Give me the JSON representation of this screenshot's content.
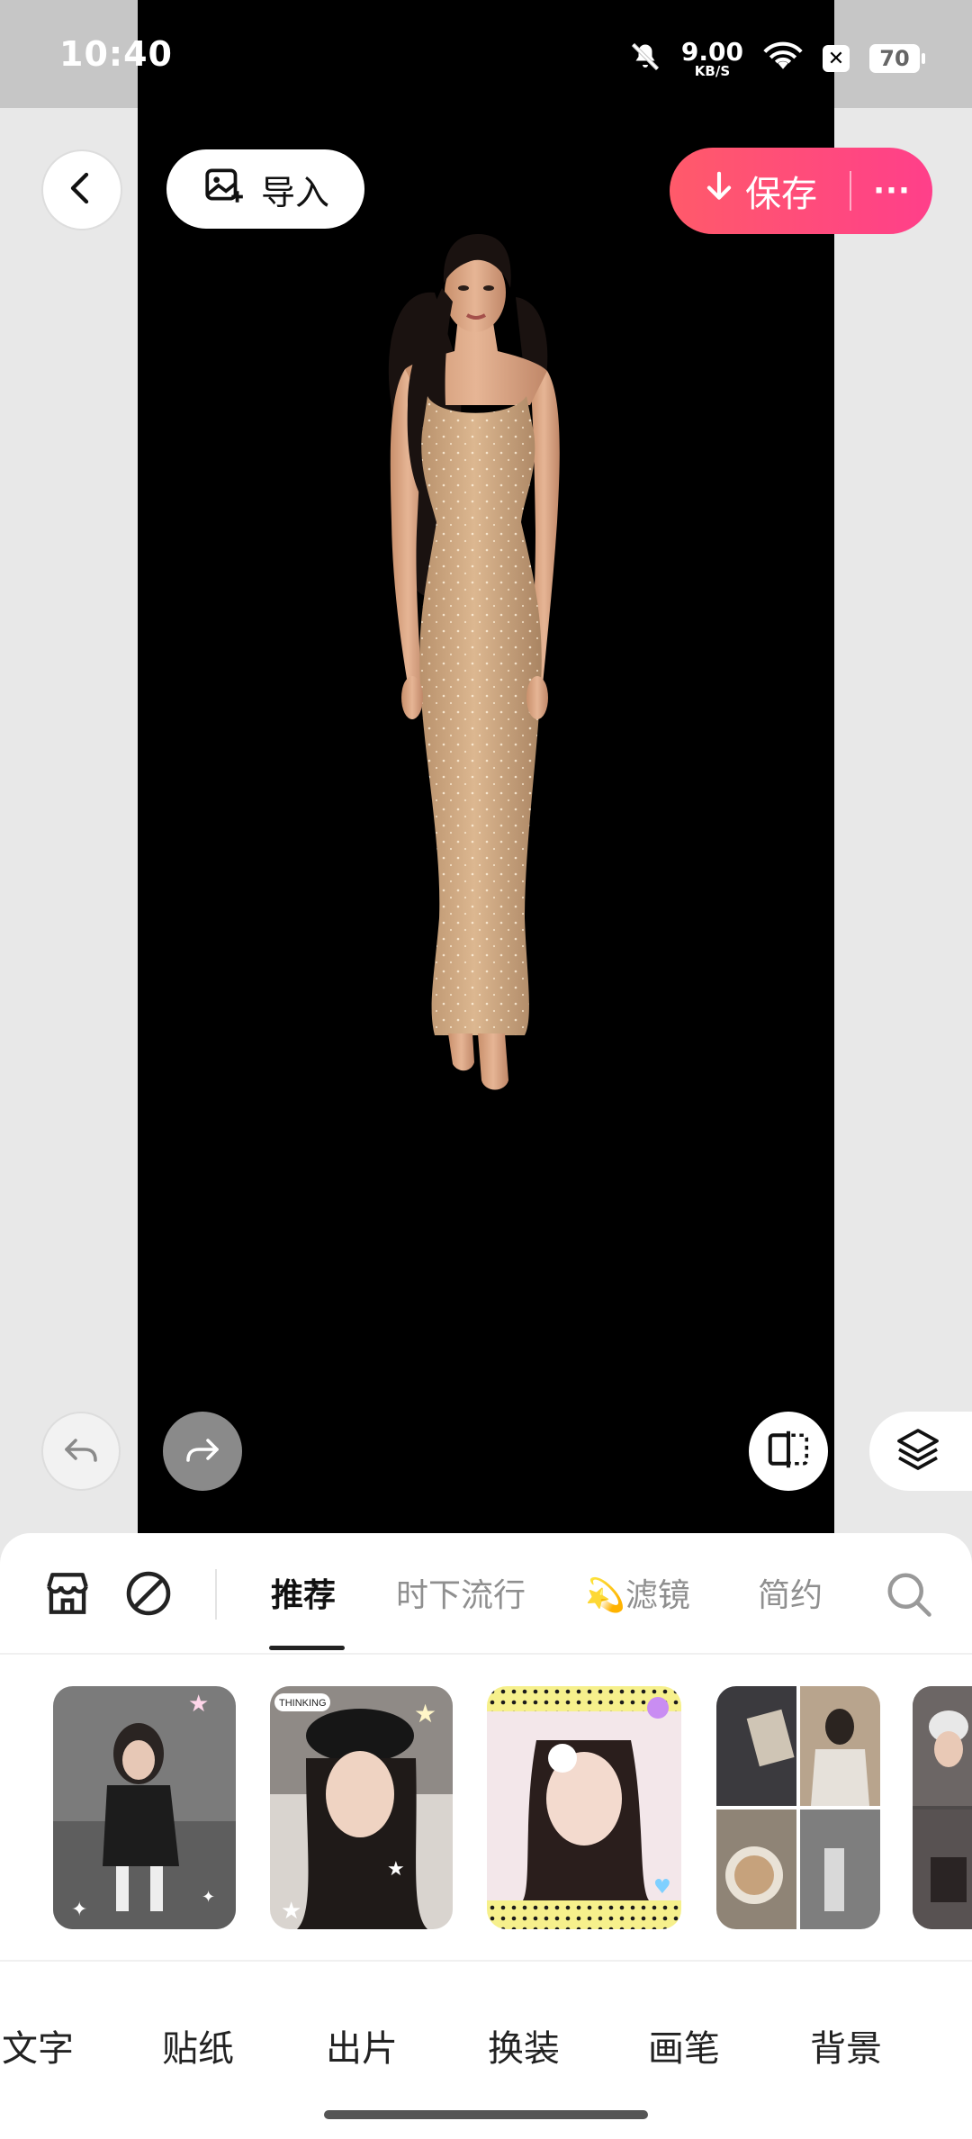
{
  "status_bar": {
    "time": "10:40",
    "net_speed": "9.00",
    "net_unit": "KB/S",
    "battery": "70",
    "icons": [
      "mute-bell-icon",
      "wifi-icon",
      "close-box-icon",
      "battery-icon"
    ]
  },
  "header": {
    "back_icon": "chevron-left-icon",
    "import_label": "导入",
    "import_icon": "image-add-icon",
    "save_label": "保存",
    "save_icon": "download-arrow-icon",
    "more_label": "···"
  },
  "canvas_controls": {
    "undo_icon": "undo-icon",
    "redo_icon": "redo-icon",
    "compare_icon": "compare-icon",
    "layers_icon": "layers-icon"
  },
  "filter_panel": {
    "store_icon": "store-icon",
    "none_icon": "none-circle-icon",
    "tabs": [
      {
        "label": "推荐",
        "active": true
      },
      {
        "label": "时下流行",
        "active": false
      },
      {
        "label": "💫滤镜",
        "active": false
      },
      {
        "label": "简约",
        "active": false
      }
    ],
    "search_icon": "search-icon",
    "templates": [
      {
        "name": "template-1"
      },
      {
        "name": "template-2",
        "tag": "THINKING"
      },
      {
        "name": "template-3"
      },
      {
        "name": "template-4"
      },
      {
        "name": "template-5"
      }
    ]
  },
  "tools": [
    "文字",
    "贴纸",
    "出片",
    "换装",
    "画笔",
    "背景"
  ],
  "colors": {
    "accent_gradient_start": "#ff5a6a",
    "accent_gradient_end": "#ff3f8a",
    "canvas_bg": "#000000",
    "panel_bg": "#ffffff"
  }
}
